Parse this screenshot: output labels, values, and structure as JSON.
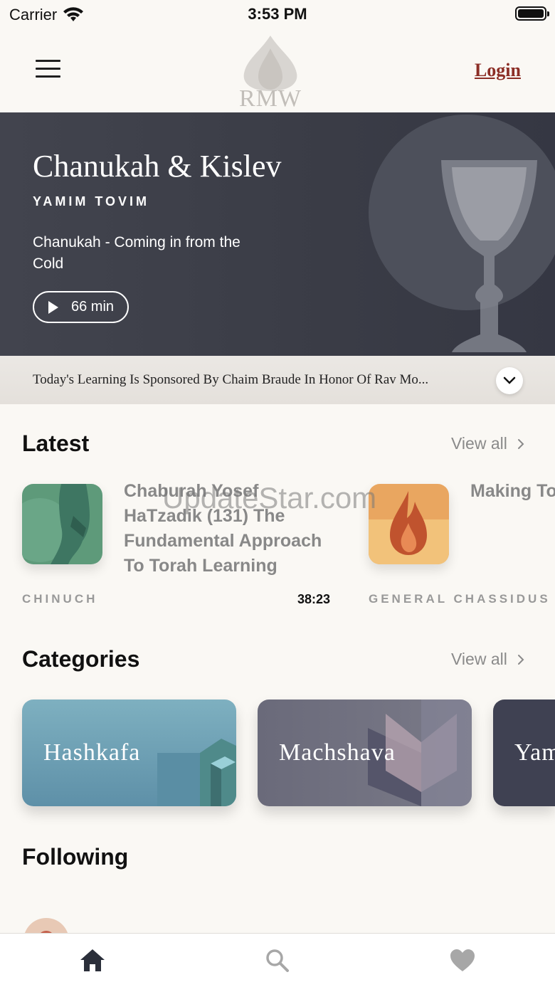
{
  "status_bar": {
    "carrier": "Carrier",
    "time": "3:53 PM"
  },
  "header": {
    "logo_text": "RMW",
    "login_label": "Login"
  },
  "hero": {
    "title": "Chanukah & Kislev",
    "subtitle": "YAMIM TOVIM",
    "description": "Chanukah - Coming in from the Cold",
    "duration": "66 min"
  },
  "sponsor": {
    "text": "Today's Learning Is Sponsored By Chaim Braude In Honor Of Rav Mo..."
  },
  "latest": {
    "title": "Latest",
    "view_all": "View all",
    "items": [
      {
        "title": "Chaburah Yosef HaTzadik (131) The Fundamental Approach To Torah Learning",
        "category": "CHINUCH",
        "duration": "38:23"
      },
      {
        "title": "Making To - Launchin Tfilot Proj",
        "category": "GENERAL CHASSIDUS",
        "duration": ""
      }
    ]
  },
  "watermark": "UpdateStar.com",
  "categories": {
    "title": "Categories",
    "view_all": "View all",
    "items": [
      {
        "label": "Hashkafa"
      },
      {
        "label": "Machshava"
      },
      {
        "label": "Yam"
      }
    ]
  },
  "following": {
    "title": "Following"
  },
  "tabbar": {
    "tabs": [
      "home-icon",
      "search-icon",
      "heart-icon"
    ]
  },
  "colors": {
    "accent": "#8c2e26",
    "hero_bg": "#3c3e48",
    "background": "#faf8f4"
  }
}
